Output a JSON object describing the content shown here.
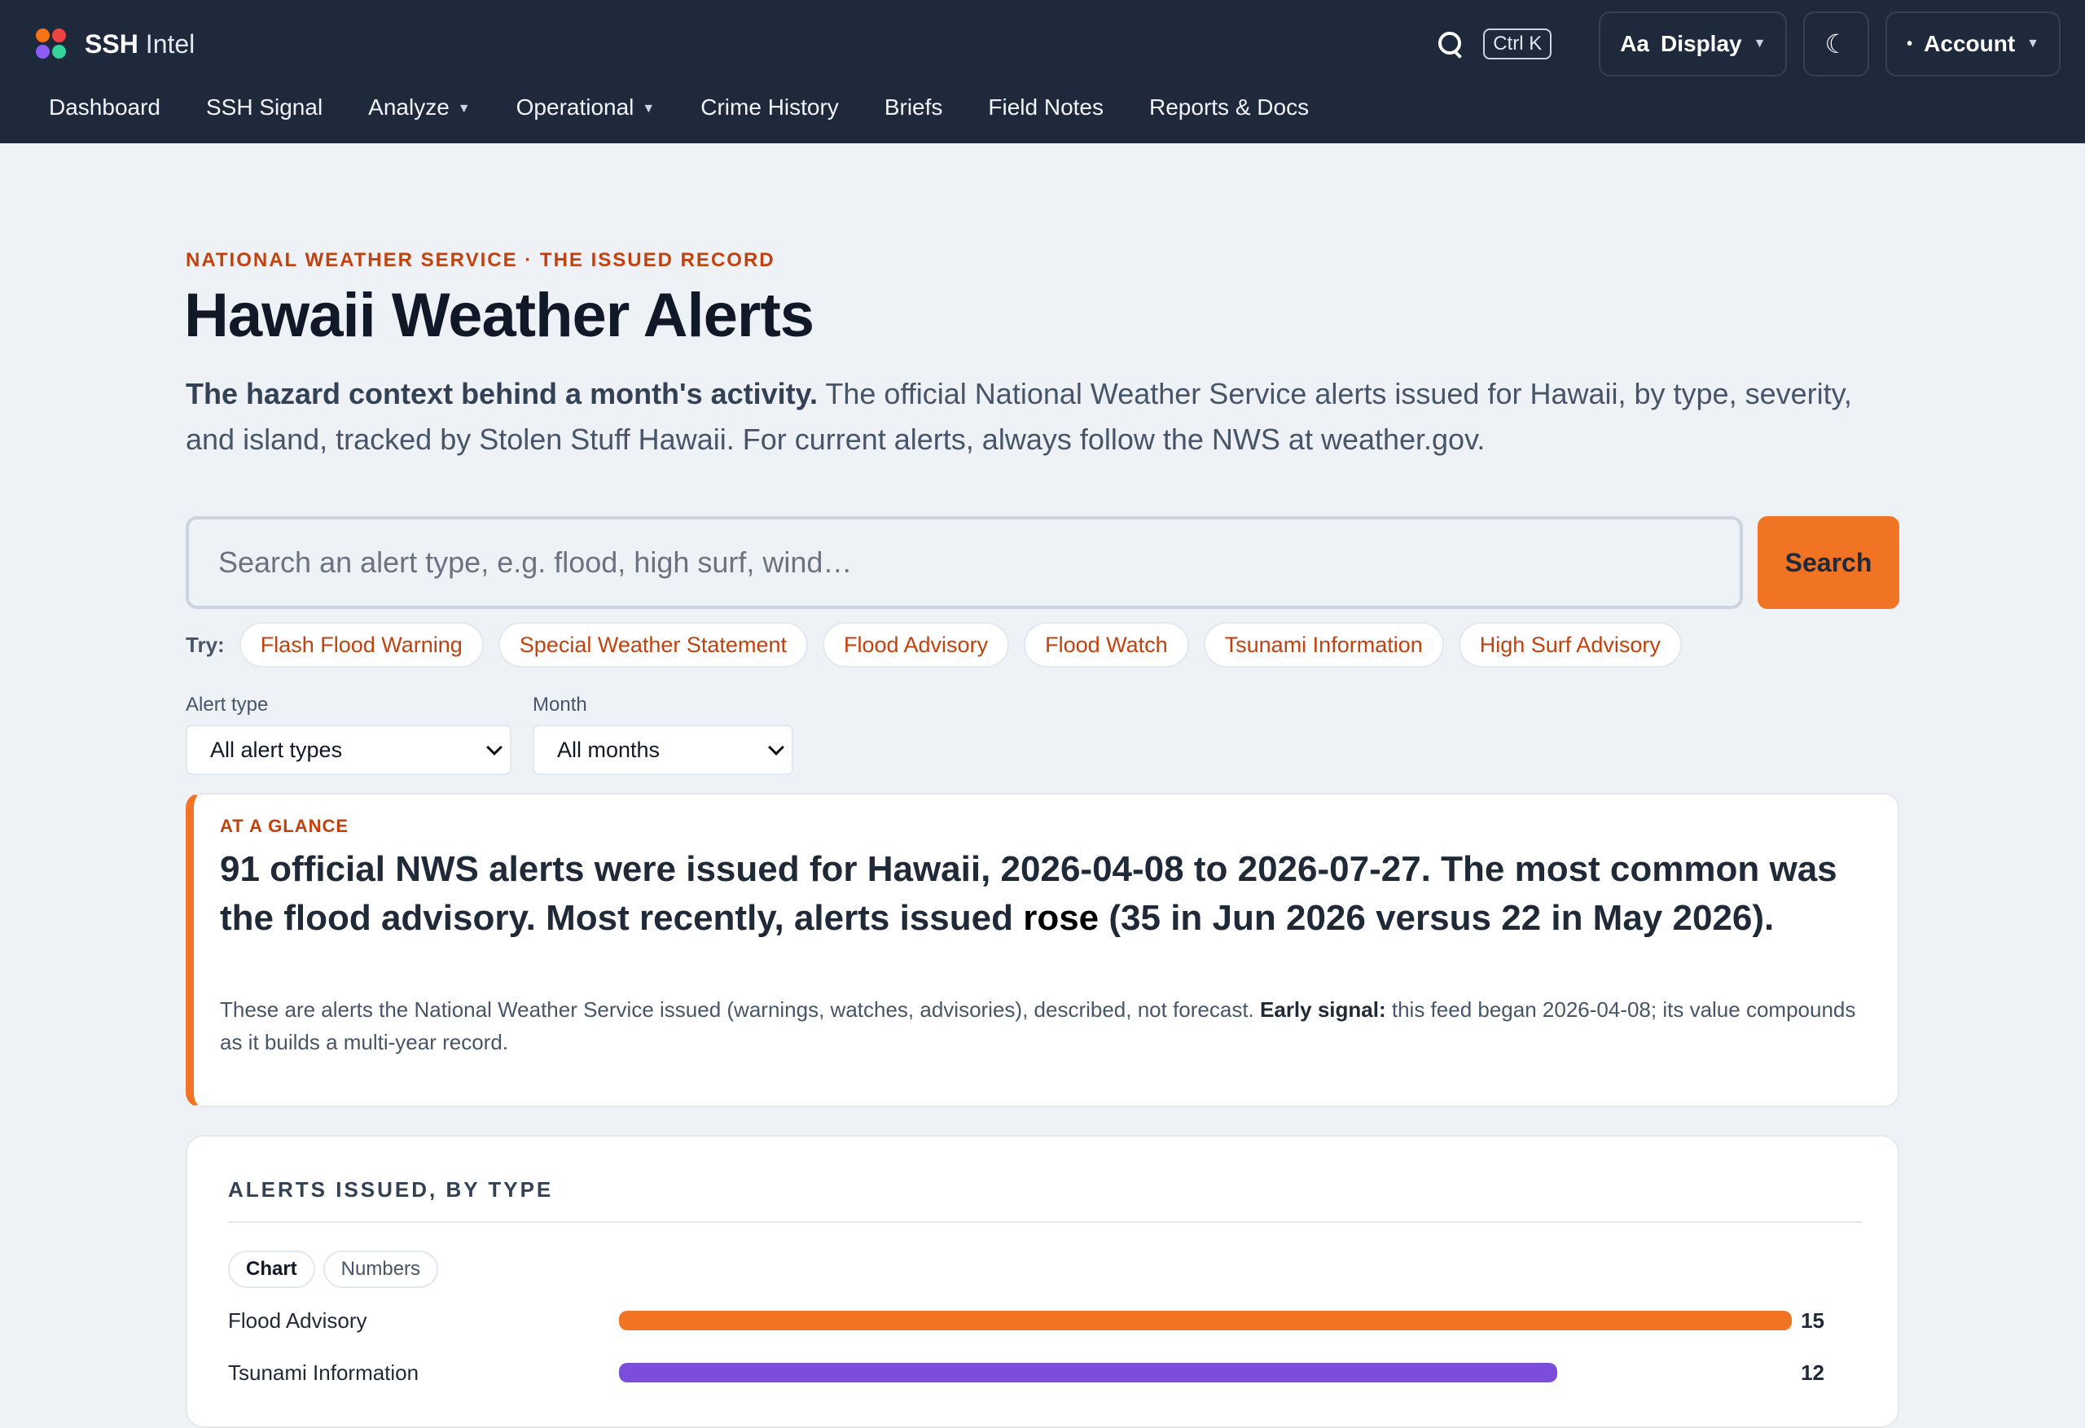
{
  "brand": {
    "name": "SSH",
    "sub": "Intel"
  },
  "topbar": {
    "shortcut": "Ctrl K",
    "display_label": "Display",
    "display_prefix": "Aa",
    "theme_icon": "moon-icon",
    "account_label": "Account"
  },
  "nav": [
    {
      "label": "Dashboard",
      "dropdown": false
    },
    {
      "label": "SSH Signal",
      "dropdown": false
    },
    {
      "label": "Analyze",
      "dropdown": true
    },
    {
      "label": "Operational",
      "dropdown": true
    },
    {
      "label": "Crime History",
      "dropdown": false
    },
    {
      "label": "Briefs",
      "dropdown": false
    },
    {
      "label": "Field Notes",
      "dropdown": false
    },
    {
      "label": "Reports & Docs",
      "dropdown": false
    }
  ],
  "page": {
    "eyebrow": "NATIONAL WEATHER SERVICE · THE ISSUED RECORD",
    "title": "Hawaii Weather Alerts",
    "lede_strong": "The hazard context behind a month's activity.",
    "lede_rest": " The official National Weather Service alerts issued for Hawaii, by type, severity, and island, tracked by Stolen Stuff Hawaii. For current alerts, always follow the NWS at weather.gov."
  },
  "search": {
    "placeholder": "Search an alert type, e.g. flood, high surf, wind…",
    "value": "",
    "button": "Search"
  },
  "try": {
    "label": "Try:",
    "chips": [
      "Flash Flood Warning",
      "Special Weather Statement",
      "Flood Advisory",
      "Flood Watch",
      "Tsunami Information",
      "High Surf Advisory"
    ]
  },
  "filters": {
    "alert_type": {
      "label": "Alert type",
      "value": "All alert types"
    },
    "month": {
      "label": "Month",
      "value": "All months"
    }
  },
  "glance": {
    "eyebrow": "AT A GLANCE",
    "head_a": "91 official NWS alerts were issued for Hawaii, 2026-04-08 to 2026-07-27. The most common was the flood advisory. Most recently, alerts issued ",
    "head_strong": "rose",
    "head_b": " (35 in Jun 2026 versus 22 in May 2026).",
    "note_a": "These are alerts the National Weather Service issued (warnings, watches, advisories), described, not forecast. ",
    "note_strong": "Early signal:",
    "note_b": " this feed began 2026-04-08; its value compounds as it builds a multi-year record."
  },
  "card": {
    "title": "ALERTS ISSUED, BY TYPE",
    "toggle": [
      "Chart",
      "Numbers"
    ],
    "active_toggle": "Chart"
  },
  "chart_data": {
    "type": "bar",
    "orientation": "horizontal",
    "categories": [
      "Flood Advisory",
      "Tsunami Information"
    ],
    "values": [
      15,
      12
    ],
    "colors": [
      "#f07424",
      "#7c4ddb"
    ],
    "xlim": [
      0,
      15
    ]
  }
}
